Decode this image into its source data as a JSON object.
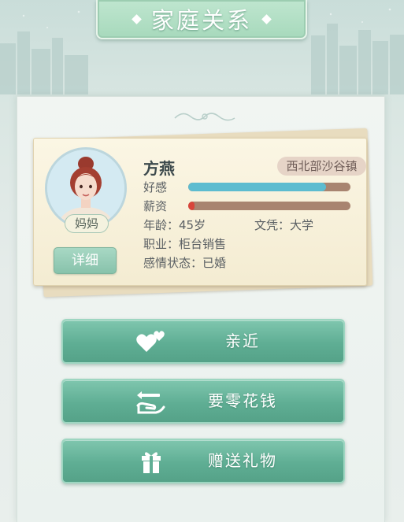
{
  "title": "家庭关系",
  "character": {
    "name": "方燕",
    "role": "妈妈",
    "region": "西北部沙谷镇",
    "detail_label": "详细",
    "stats": {
      "favor_label": "好感",
      "favor_level": 0.85,
      "salary_label": "薪资",
      "salary_level": 0.04
    },
    "info": {
      "age": "年龄：45岁",
      "education": "文凭：大学",
      "job": "职业：柜台销售",
      "relationship": "感情状态：已婚"
    }
  },
  "actions": [
    {
      "label": "亲近",
      "icon": "hearts-icon"
    },
    {
      "label": "要零花钱",
      "icon": "money-exchange-icon"
    },
    {
      "label": "赠送礼物",
      "icon": "gift-icon"
    }
  ],
  "colors": {
    "favor_bar": "#5dbcd0",
    "salary_bar": "#d8453a",
    "bar_track": "#a88470",
    "button_green": "#5fae94"
  }
}
